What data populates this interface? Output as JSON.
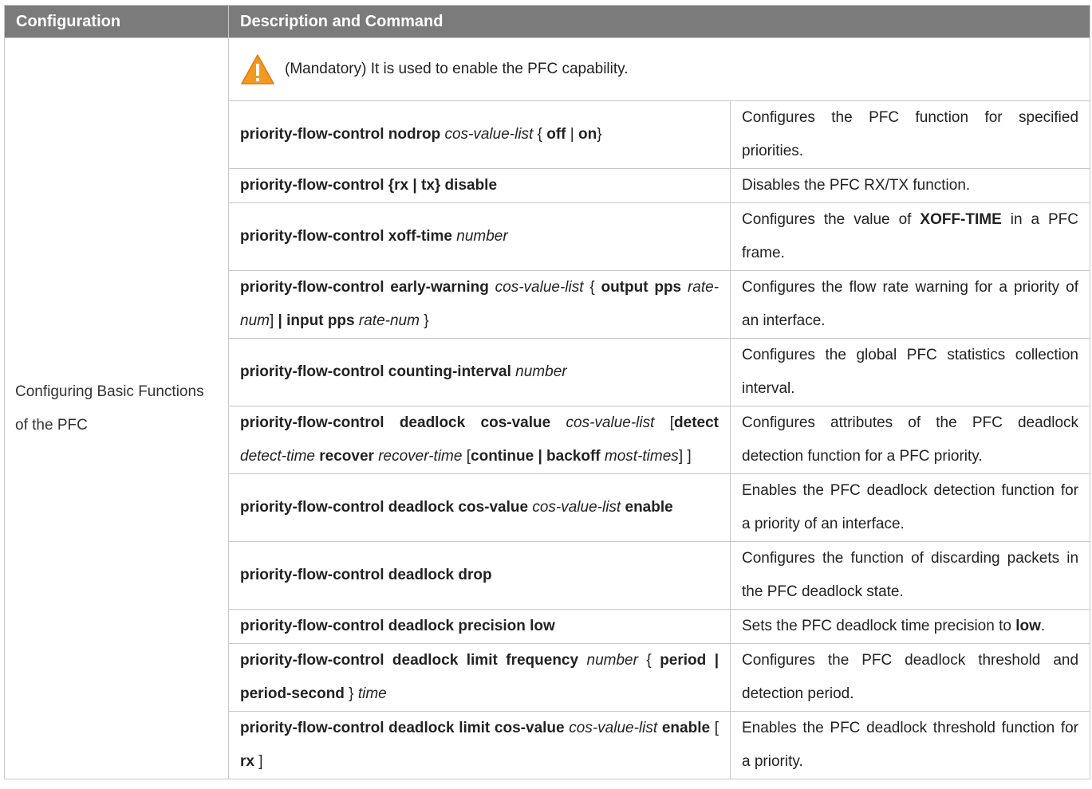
{
  "header": {
    "configuration": "Configuration",
    "description": "Description and Command"
  },
  "config_name": "Configuring Basic Functions of the PFC",
  "notice": {
    "icon": "warning-icon",
    "text": "(Mandatory) It is used to enable the PFC capability."
  },
  "colors": {
    "header_bg": "#7b7b7b",
    "warning_orange": "#f29a1f",
    "border": "#c8c8c8"
  },
  "rows": [
    {
      "command": [
        {
          "t": "priority-flow-control nodrop",
          "s": "b"
        },
        {
          "t": " ",
          "s": "n"
        },
        {
          "t": "cos-value-list",
          "s": "i"
        },
        {
          "t": " { ",
          "s": "n"
        },
        {
          "t": "off",
          "s": "b"
        },
        {
          "t": " | ",
          "s": "n"
        },
        {
          "t": "on",
          "s": "b"
        },
        {
          "t": "}",
          "s": "n"
        }
      ],
      "description": [
        {
          "t": "Configures the PFC function for specified priorities.",
          "s": "n"
        }
      ]
    },
    {
      "command": [
        {
          "t": "priority-flow-control {rx | tx} disable",
          "s": "b"
        }
      ],
      "description": [
        {
          "t": "Disables the PFC RX/TX function.",
          "s": "n"
        }
      ]
    },
    {
      "command": [
        {
          "t": "priority-flow-control xoff-time",
          "s": "b"
        },
        {
          "t": " ",
          "s": "n"
        },
        {
          "t": "number",
          "s": "i"
        }
      ],
      "description": [
        {
          "t": "Configures the value of ",
          "s": "n"
        },
        {
          "t": "XOFF-TIME",
          "s": "b"
        },
        {
          "t": " in a PFC frame.",
          "s": "n"
        }
      ]
    },
    {
      "command": [
        {
          "t": "priority-flow-control early-warning",
          "s": "b"
        },
        {
          "t": " ",
          "s": "n"
        },
        {
          "t": "cos-value-list",
          "s": "i"
        },
        {
          "t": " { ",
          "s": "n"
        },
        {
          "t": "output pps",
          "s": "b"
        },
        {
          "t": " ",
          "s": "n"
        },
        {
          "t": "rate-num",
          "s": "i"
        },
        {
          "t": "] ",
          "s": "n"
        },
        {
          "t": "| input pps",
          "s": "b"
        },
        {
          "t": " ",
          "s": "n"
        },
        {
          "t": "rate-num",
          "s": "i"
        },
        {
          "t": " }",
          "s": "n"
        }
      ],
      "description": [
        {
          "t": "Configures the flow rate warning for a priority of an interface.",
          "s": "n"
        }
      ]
    },
    {
      "command": [
        {
          "t": "priority-flow-control counting-interval",
          "s": "b"
        },
        {
          "t": " ",
          "s": "n"
        },
        {
          "t": "number",
          "s": "i"
        }
      ],
      "description": [
        {
          "t": "Configures the global PFC statistics collection interval.",
          "s": "n"
        }
      ]
    },
    {
      "command": [
        {
          "t": "priority-flow-control deadlock cos-value",
          "s": "b"
        },
        {
          "t": " ",
          "s": "n"
        },
        {
          "t": "cos-value-list",
          "s": "i"
        },
        {
          "t": " [",
          "s": "n"
        },
        {
          "t": "detect",
          "s": "b"
        },
        {
          "t": " ",
          "s": "n"
        },
        {
          "t": "detect-time",
          "s": "i"
        },
        {
          "t": " ",
          "s": "n"
        },
        {
          "t": "recover",
          "s": "b"
        },
        {
          "t": " ",
          "s": "n"
        },
        {
          "t": "recover-time",
          "s": "i"
        },
        {
          "t": " [",
          "s": "n"
        },
        {
          "t": "continue | backoff",
          "s": "b"
        },
        {
          "t": " ",
          "s": "n"
        },
        {
          "t": "most-times",
          "s": "i"
        },
        {
          "t": "] ]",
          "s": "n"
        }
      ],
      "description": [
        {
          "t": "Configures attributes of the PFC deadlock detection function for a PFC priority.",
          "s": "n"
        }
      ]
    },
    {
      "command": [
        {
          "t": "priority-flow-control deadlock cos-value",
          "s": "b"
        },
        {
          "t": " ",
          "s": "n"
        },
        {
          "t": "cos-value-list",
          "s": "i"
        },
        {
          "t": " ",
          "s": "n"
        },
        {
          "t": "enable",
          "s": "b"
        }
      ],
      "description": [
        {
          "t": "Enables the PFC deadlock detection function for a priority of an interface.",
          "s": "n"
        }
      ]
    },
    {
      "command": [
        {
          "t": "priority-flow-control deadlock drop",
          "s": "b"
        }
      ],
      "description": [
        {
          "t": "Configures the function of discarding packets in the PFC deadlock state.",
          "s": "n"
        }
      ]
    },
    {
      "command": [
        {
          "t": "priority-flow-control deadlock precision low",
          "s": "b"
        }
      ],
      "description": [
        {
          "t": "Sets the PFC deadlock time precision to ",
          "s": "n"
        },
        {
          "t": "low",
          "s": "b"
        },
        {
          "t": ".",
          "s": "n"
        }
      ]
    },
    {
      "command": [
        {
          "t": "priority-flow-control deadlock limit frequency",
          "s": "b"
        },
        {
          "t": " ",
          "s": "n"
        },
        {
          "t": "number",
          "s": "i"
        },
        {
          "t": " { ",
          "s": "n"
        },
        {
          "t": "period | period-second",
          "s": "b"
        },
        {
          "t": " } ",
          "s": "n"
        },
        {
          "t": "time",
          "s": "i"
        }
      ],
      "description": [
        {
          "t": "Configures the PFC deadlock threshold and detection period.",
          "s": "n"
        }
      ]
    },
    {
      "command": [
        {
          "t": "priority-flow-control deadlock limit cos-value",
          "s": "b"
        },
        {
          "t": " ",
          "s": "n"
        },
        {
          "t": "cos-value-list",
          "s": "i"
        },
        {
          "t": " ",
          "s": "n"
        },
        {
          "t": "enable",
          "s": "b"
        },
        {
          "t": " [ ",
          "s": "n"
        },
        {
          "t": "rx",
          "s": "b"
        },
        {
          "t": " ]",
          "s": "n"
        }
      ],
      "description": [
        {
          "t": "Enables the PFC deadlock threshold function for a priority.",
          "s": "n"
        }
      ]
    }
  ]
}
